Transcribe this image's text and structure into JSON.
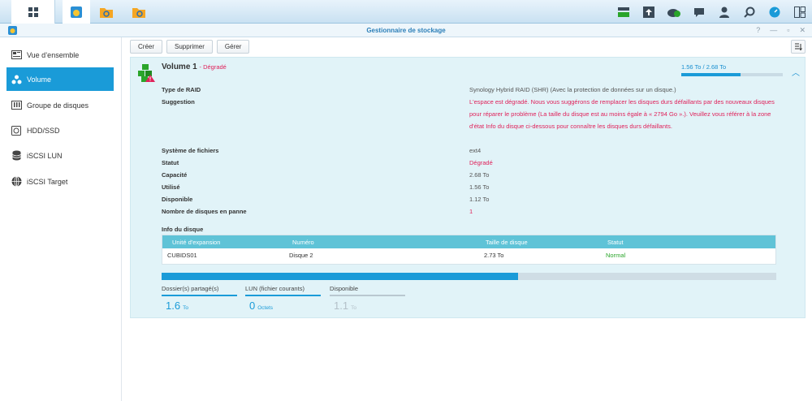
{
  "window": {
    "title": "Gestionnaire de stockage"
  },
  "sidebar": {
    "items": [
      {
        "label": "Vue d’ensemble",
        "icon": "overview-icon"
      },
      {
        "label": "Volume",
        "icon": "volume-icon",
        "active": true
      },
      {
        "label": "Groupe de disques",
        "icon": "disk-group-icon"
      },
      {
        "label": "HDD/SSD",
        "icon": "hdd-icon"
      },
      {
        "label": "iSCSI LUN",
        "icon": "database-icon"
      },
      {
        "label": "iSCSI Target",
        "icon": "globe-icon"
      }
    ]
  },
  "toolbar": {
    "create": "Créer",
    "delete": "Supprimer",
    "manage": "Gérer"
  },
  "volume": {
    "name": "Volume 1",
    "status_suffix": "- Dégradé",
    "usage_text": "1.56 To / 2.68 To",
    "usage_fraction": 0.58,
    "properties": [
      {
        "key": "Type de RAID",
        "value": "Synology Hybrid RAID (SHR) (Avec la protection de données sur un disque.)",
        "red": false
      },
      {
        "key": "Suggestion",
        "value": "L'espace est dégradé. Nous vous suggérons de remplacer les disques durs défaillants par des nouveaux disques pour réparer le problème (La taille du disque est au moins égale à « 2794 Go ».). Veuillez vous référer à la zone d'état Info du disque ci-dessous pour connaître les disques durs défaillants.",
        "red": true
      },
      {
        "key": "Système de fichiers",
        "value": "ext4",
        "red": false
      },
      {
        "key": "Statut",
        "value": "Dégradé",
        "red": true
      },
      {
        "key": "Capacité",
        "value": "2.68 To",
        "red": false
      },
      {
        "key": "Utilisé",
        "value": "1.56 To",
        "red": false
      },
      {
        "key": "Disponible",
        "value": "1.12 To",
        "red": false
      },
      {
        "key": "Nombre de disques en panne",
        "value": "1",
        "red": true
      }
    ],
    "disk_info": {
      "heading": "Info du disque",
      "columns": [
        "Unité d'expansion",
        "Numéro",
        "Taille de disque",
        "Statut"
      ],
      "rows": [
        [
          "CUBIDS01",
          "Disque 2",
          "2.73 To",
          "Normal"
        ]
      ]
    },
    "capacity_fraction": 0.58,
    "stats": [
      {
        "label": "Dossier(s) partagé(s)",
        "value": "1.6",
        "unit": "To"
      },
      {
        "label": "LUN (fichier courants)",
        "value": "0",
        "unit": "Octets"
      },
      {
        "label": "Disponible",
        "value": "1.1",
        "unit": "To"
      }
    ]
  },
  "colors": {
    "accent": "#1a9bd8",
    "danger": "#e0215a",
    "ok": "#2aa52a",
    "table_header": "#5fc3d7"
  }
}
